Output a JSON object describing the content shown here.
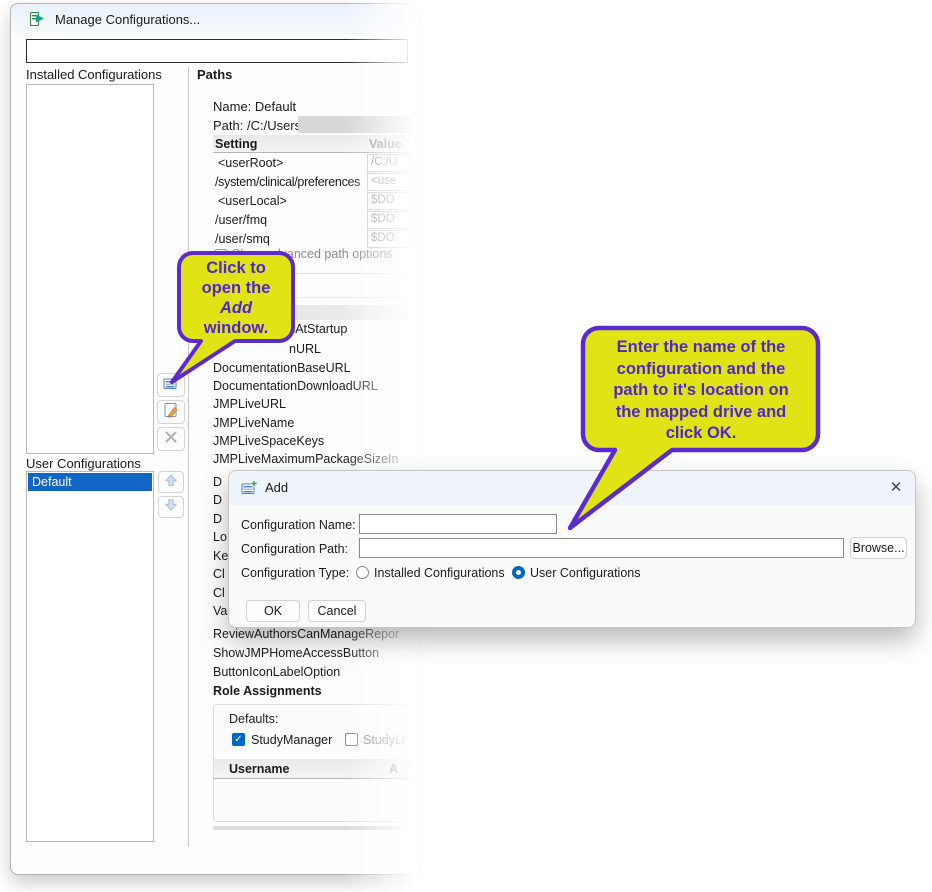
{
  "window": {
    "title": "Manage Configurations...",
    "filter_value": "",
    "installed_label": "Installed Configurations",
    "user_label": "User Configurations",
    "user_items": [
      "Default"
    ],
    "paths_label": "Paths",
    "name_line": "Name: Default",
    "path_prefix": "Path:   /C:/Users/",
    "table": {
      "setting_header": "Setting",
      "value_header": "Value",
      "rows": [
        {
          "setting": "<userRoot>",
          "value": "/C:/U"
        },
        {
          "setting": "/system/clinical/preferences",
          "value": "<use"
        },
        {
          "setting": "<userLocal>",
          "value": "$DO"
        },
        {
          "setting": "/user/fmq",
          "value": "$DO"
        },
        {
          "setting": "/user/smq",
          "value": "$DO"
        }
      ]
    },
    "advanced_checkbox": "Show advanced path options",
    "settings_list": [
      "esAtStartup",
      "nURL",
      "DocumentationBaseURL",
      "DocumentationDownloadURL",
      "JMPLiveURL",
      "JMPLiveName",
      "JMPLiveSpaceKeys",
      "JMPLiveMaximumPackageSizeIn"
    ],
    "settings_fragments": [
      "D",
      "D",
      "D",
      "Lo",
      "Ke",
      "Cl",
      "Cl",
      "Va"
    ],
    "settings_list2": [
      "ReviewAuthorsCanManageRepor",
      "ShowJMPHomeAccessButton",
      "ButtonIconLabelOption"
    ],
    "role_assignments_label": "Role Assignments",
    "defaults": {
      "label": "Defaults:",
      "checkbox_checked_label": "StudyManager",
      "checkbox_unchecked_label": "StudyLi",
      "username_header": "Username",
      "second_column_fragment": "A"
    }
  },
  "dialog": {
    "title": "Add",
    "name_label": "Configuration Name:",
    "name_value": "",
    "path_label": "Configuration Path:",
    "path_value": "",
    "type_label": "Configuration Type:",
    "radio_installed_label": "Installed Configurations",
    "radio_user_label": "User Configurations",
    "browse_label": "Browse...",
    "ok_label": "OK",
    "cancel_label": "Cancel"
  },
  "icons": {
    "close": "✕"
  },
  "callouts": {
    "c1": {
      "line1": "Click to",
      "line2": "open the",
      "line3": "Add",
      "line4": "window."
    },
    "c2": {
      "line1": "Enter the name of the",
      "line2": "configuration and the",
      "line3": "path to it's location on",
      "line4": "the mapped drive and",
      "line5": "click OK."
    }
  },
  "colors": {
    "callout_fill": "#e0e414",
    "callout_accent": "#5b2bd0",
    "selection_blue": "#1166c5",
    "accent_blue": "#0067c0"
  }
}
